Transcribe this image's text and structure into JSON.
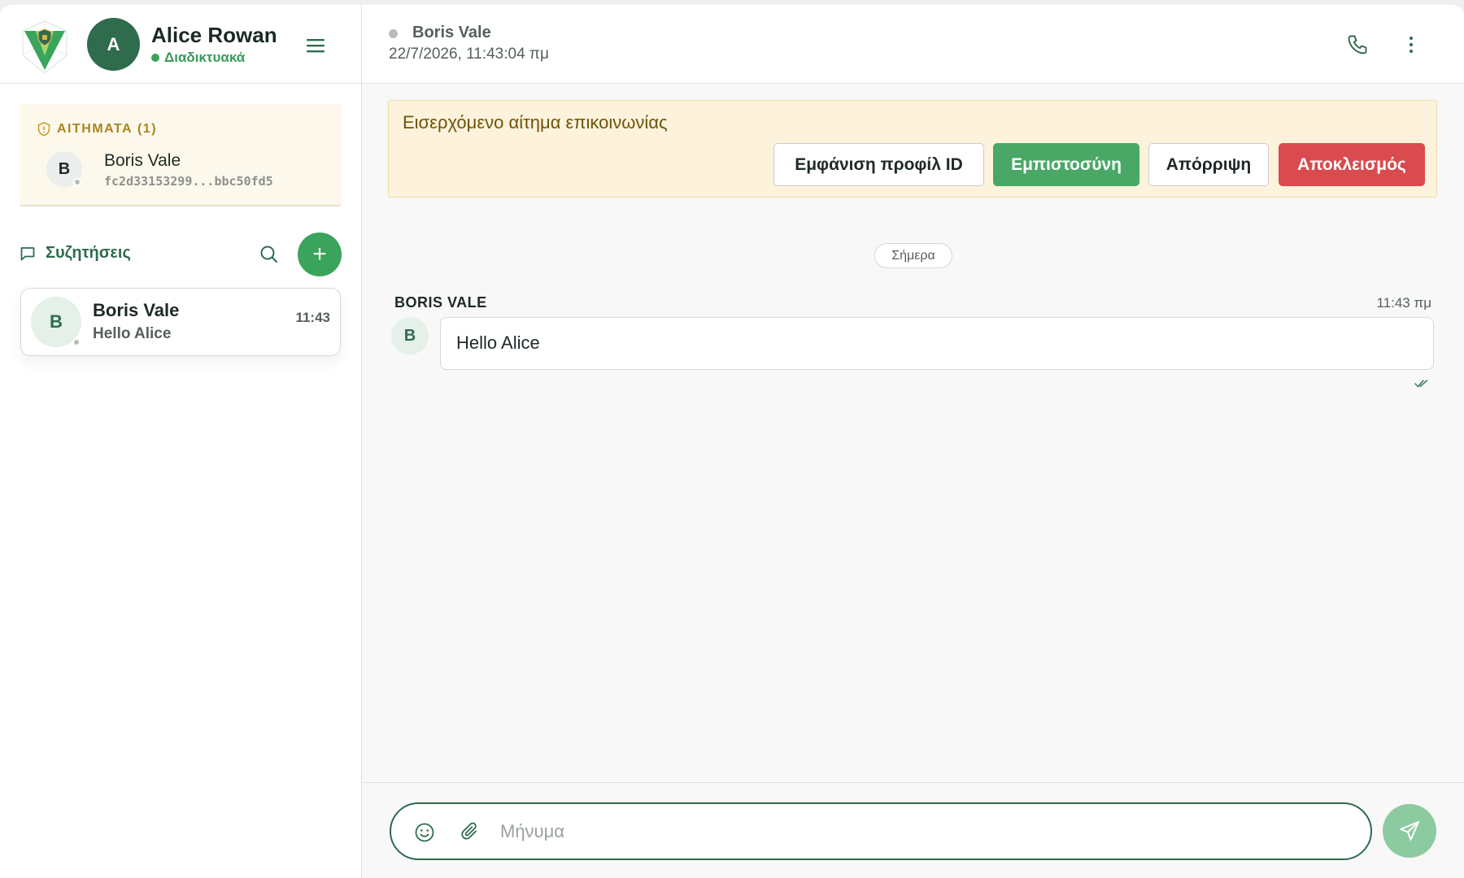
{
  "colors": {
    "accent_dark": "#2f6b4d",
    "accent_green": "#3aa35c",
    "trust_green": "#49a866",
    "block_red": "#d94b4f",
    "warning_bg": "#fdf3dd",
    "warning_text": "#6e5206"
  },
  "sidebar": {
    "logo_icon": "shield-v-logo-icon",
    "user": {
      "initial": "A",
      "name": "Alice Rowan",
      "status": "Διαδικτυακά"
    },
    "menu_icon": "hamburger-menu-icon",
    "requests": {
      "title": "ΑΙΤΗΜΑΤΑ (1)",
      "icon": "shield-alert-icon",
      "items": [
        {
          "initial": "B",
          "name": "Boris Vale",
          "id": "fc2d33153299...bbc50fd5"
        }
      ]
    },
    "conversations": {
      "title": "Συζητήσεις",
      "icon": "chat-bubble-icon",
      "search_icon": "search-icon",
      "add_label": "+",
      "items": [
        {
          "initial": "B",
          "name": "Boris Vale",
          "preview": "Hello Alice",
          "time": "11:43"
        }
      ]
    }
  },
  "chat": {
    "header": {
      "peer_name": "Boris Vale",
      "peer_time": "22/7/2026, 11:43:04 πμ",
      "call_icon": "phone-icon",
      "more_icon": "more-vertical-icon"
    },
    "request_banner": {
      "text": "Εισερχόμενο αίτημα επικοινωνίας",
      "buttons": {
        "profile": "Εμφάνιση προφίλ ID",
        "trust": "Εμπιστοσύνη",
        "reject": "Απόρριψη",
        "block": "Αποκλεισμός"
      }
    },
    "day_separator": "Σήμερα",
    "messages": [
      {
        "sender": "BORIS VALE",
        "initial": "B",
        "time": "11:43 πμ",
        "text": "Hello Alice",
        "status_icon": "double-check-icon"
      }
    ],
    "composer": {
      "placeholder": "Μήνυμα",
      "emoji_icon": "smiley-icon",
      "attach_icon": "paperclip-icon",
      "send_icon": "send-icon"
    }
  }
}
